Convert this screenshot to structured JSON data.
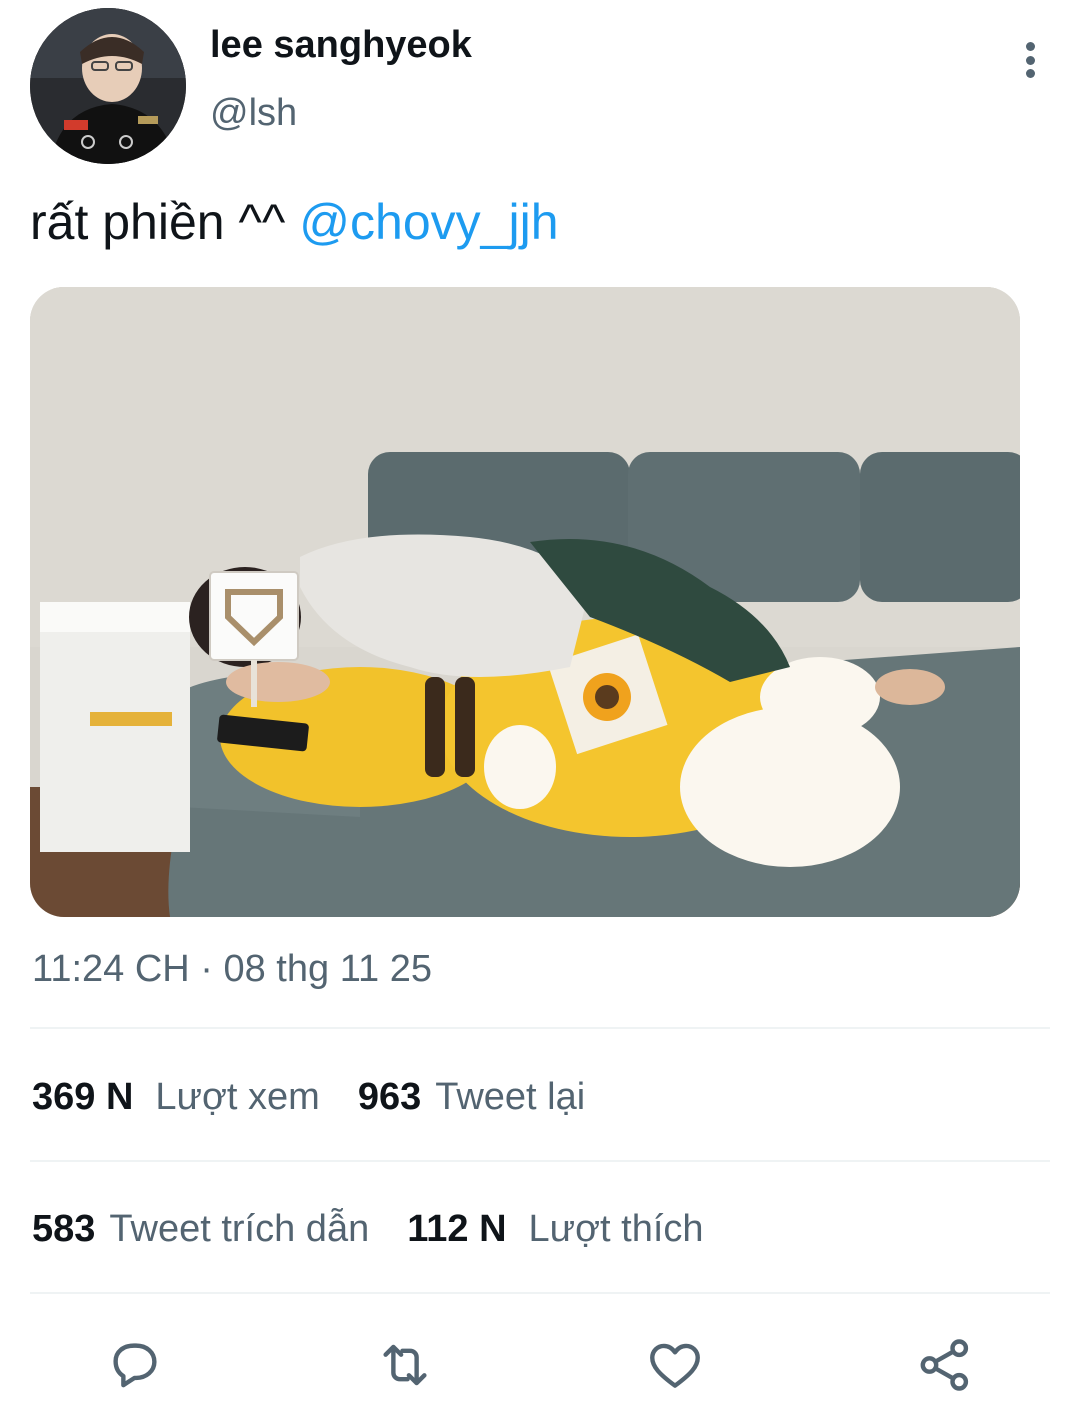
{
  "author": {
    "display_name": "lee sanghyeok",
    "handle": "@lsh"
  },
  "tweet": {
    "text": "rất phiền ^^ ",
    "mention": "@chovy_jjh",
    "timestamp": "11:24 CH · 08 thg 11 25"
  },
  "stats": {
    "views_count": "369 N",
    "views_label": "Lượt xem",
    "retweets_count": "963",
    "retweets_label": "Tweet lại",
    "quotes_count": "583",
    "quotes_label": "Tweet trích dẫn",
    "likes_count": "112 N",
    "likes_label": "Lượt thích"
  },
  "actions": [
    "reply-icon",
    "retweet-icon",
    "like-icon",
    "share-icon"
  ],
  "colors": {
    "accent": "#1d9bf0",
    "text_primary": "#0f1419",
    "text_secondary": "#536471",
    "divider": "#eff3f4"
  }
}
